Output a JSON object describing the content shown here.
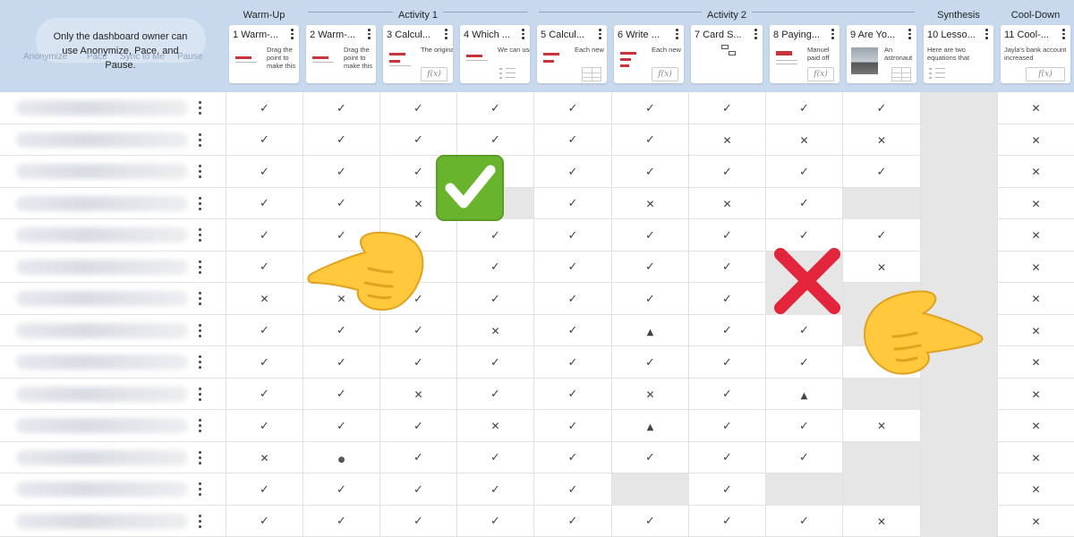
{
  "header": {
    "lock_message": "Only the dashboard owner can use Anonymize, Pace, and Pause.",
    "controls": [
      "Anonymize",
      "Pace",
      "Sync to Me",
      "Pause"
    ],
    "groups": [
      "Warm-Up",
      "Activity 1",
      "Activity 2",
      "Synthesis",
      "Cool-Down"
    ]
  },
  "screens": [
    {
      "num": "1",
      "title": "Warm-...",
      "note": "Drag the point to make this"
    },
    {
      "num": "2",
      "title": "Warm-...",
      "note": "Drag the point to make this"
    },
    {
      "num": "3",
      "title": "Calcul...",
      "note": "The original"
    },
    {
      "num": "4",
      "title": "Which ...",
      "note": "We can use"
    },
    {
      "num": "5",
      "title": "Calcul...",
      "note": "Each new"
    },
    {
      "num": "6",
      "title": "Write ...",
      "note": "Each new"
    },
    {
      "num": "7",
      "title": "Card S...",
      "note": ""
    },
    {
      "num": "8",
      "title": "Paying...",
      "note": "Manuel paid off"
    },
    {
      "num": "9",
      "title": "Are Yo...",
      "note": "An astronaut"
    },
    {
      "num": "10",
      "title": "Lesso...",
      "note": "Here are two equations that"
    },
    {
      "num": "11",
      "title": "Cool-...",
      "note": "Jayla's bank account increased"
    }
  ],
  "grid": [
    [
      "check",
      "check",
      "check",
      "check",
      "check",
      "check",
      "check",
      "check",
      "check",
      "synth",
      "cross"
    ],
    [
      "check",
      "check",
      "check",
      "check",
      "check",
      "check",
      "cross",
      "cross",
      "cross",
      "synth",
      "cross"
    ],
    [
      "check",
      "check",
      "check",
      "check",
      "check",
      "check",
      "check",
      "check",
      "check",
      "synth",
      "cross"
    ],
    [
      "check",
      "check",
      "cross",
      "gray",
      "check",
      "cross",
      "cross",
      "check",
      "gray",
      "synth",
      "cross"
    ],
    [
      "check",
      "check",
      "check",
      "check",
      "check",
      "check",
      "check",
      "check",
      "check",
      "synth",
      "cross"
    ],
    [
      "check",
      "check",
      "check",
      "check",
      "check",
      "check",
      "check",
      "gray",
      "cross",
      "synth",
      "cross"
    ],
    [
      "cross",
      "cross",
      "check",
      "check",
      "check",
      "check",
      "check",
      "gray",
      "gray",
      "synth",
      "cross"
    ],
    [
      "check",
      "check",
      "check",
      "cross",
      "check",
      "warn",
      "check",
      "check",
      "gray",
      "synth",
      "cross"
    ],
    [
      "check",
      "check",
      "check",
      "check",
      "check",
      "check",
      "check",
      "check",
      "cross",
      "synth",
      "cross"
    ],
    [
      "check",
      "check",
      "cross",
      "check",
      "check",
      "cross",
      "check",
      "warn",
      "gray",
      "synth",
      "cross"
    ],
    [
      "check",
      "check",
      "check",
      "cross",
      "check",
      "warn",
      "check",
      "check",
      "cross",
      "synth",
      "cross"
    ],
    [
      "cross",
      "dot",
      "check",
      "check",
      "check",
      "check",
      "check",
      "check",
      "gray",
      "synth",
      "cross"
    ],
    [
      "check",
      "check",
      "check",
      "check",
      "check",
      "gray",
      "check",
      "gray",
      "gray",
      "synth",
      "cross"
    ],
    [
      "check",
      "check",
      "check",
      "check",
      "check",
      "check",
      "check",
      "check",
      "cross",
      "synth",
      "cross"
    ]
  ],
  "icons": {
    "check_emoji": "white-heavy-check-mark-emoji",
    "cross_emoji": "red-cross-mark-emoji",
    "hand_right": "backhand-index-pointing-right-emoji"
  },
  "colors": {
    "header_bg": "#c8d9ee",
    "check_green": "#69b42d",
    "cross_red": "#e2253a",
    "hand_yellow": "#ffc83d"
  }
}
